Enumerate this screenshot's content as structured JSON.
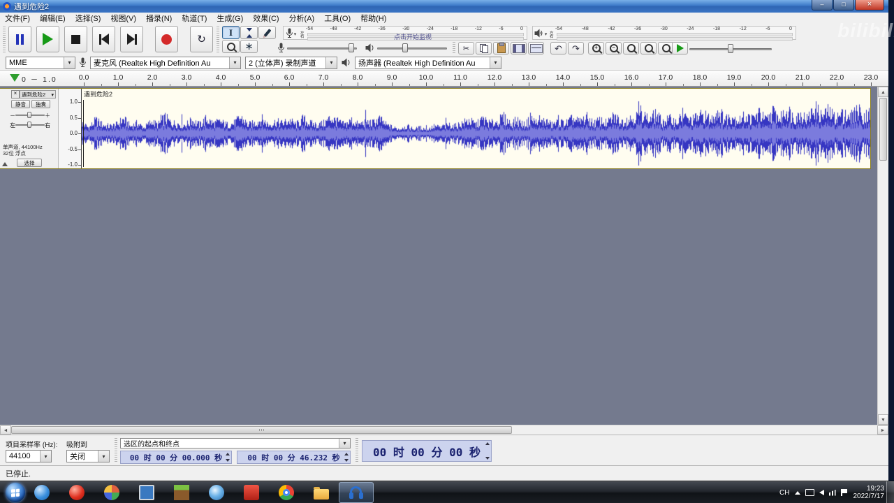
{
  "titlebar": {
    "title": "遇到危险2"
  },
  "menubar": {
    "items": [
      {
        "id": "file",
        "label": "文件(F)"
      },
      {
        "id": "edit",
        "label": "编辑(E)"
      },
      {
        "id": "select",
        "label": "选择(S)"
      },
      {
        "id": "view",
        "label": "视图(V)"
      },
      {
        "id": "transport",
        "label": "播录(N)"
      },
      {
        "id": "tracks",
        "label": "轨道(T)"
      },
      {
        "id": "generate",
        "label": "生成(G)"
      },
      {
        "id": "effect",
        "label": "效果(C)"
      },
      {
        "id": "analyze",
        "label": "分析(A)"
      },
      {
        "id": "tools",
        "label": "工具(O)"
      },
      {
        "id": "help",
        "label": "帮助(H)"
      }
    ]
  },
  "meters": {
    "scale": [
      "-54",
      "-48",
      "-42",
      "-36",
      "-30",
      "-24",
      "-18",
      "-12",
      "-6",
      "0"
    ],
    "record_hint": "点击开始监视",
    "channels": [
      "左",
      "右"
    ]
  },
  "mixer": {
    "record_level": 0.92,
    "playback_level": 0.4,
    "play_speed": 0.5
  },
  "device": {
    "host": "MME",
    "input_device": "麦克风 (Realtek High Definition Au",
    "input_channels": "2 (立体声) 录制声道",
    "output_device": "扬声器 (Realtek High Definition Au"
  },
  "timeline": {
    "pre_label": "0 － 1.0",
    "labels": [
      "0.0",
      "1.0",
      "2.0",
      "3.0",
      "4.0",
      "5.0",
      "6.0",
      "7.0",
      "8.0",
      "9.0",
      "10.0",
      "11.0",
      "12.0",
      "13.0",
      "14.0",
      "15.0",
      "16.0",
      "17.0",
      "18.0",
      "19.0",
      "20.0",
      "21.0",
      "22.0",
      "23.0"
    ]
  },
  "track": {
    "name": "遇到危险2",
    "close_glyph": "×",
    "mute_label": "静音",
    "solo_label": "独奏",
    "gain_min": "－",
    "gain_max": "＋",
    "pan_left": "左",
    "pan_right": "右",
    "info_line1": "单声道, 44100Hz",
    "info_line2": "32位 浮点",
    "select_label": "选择",
    "gain": 0.5,
    "pan": 0.5,
    "ruler": [
      "1.0",
      "0.5",
      "0.0",
      "-0.5",
      "-1.0"
    ]
  },
  "waveform": {
    "peak_color": "#3636c2",
    "rms_color": "#7b7bdd",
    "background": "#fffdf0",
    "envelope": [
      0.35,
      0.2,
      0.45,
      0.3,
      0.25,
      0.3,
      0.5,
      0.25,
      0.35,
      0.2,
      0.4,
      0.3,
      0.55,
      0.35,
      0.35,
      0.3,
      0.45,
      0.3,
      0.5,
      0.35,
      0.4,
      0.3,
      0.35,
      0.55,
      0.3,
      0.35,
      0.5,
      0.3,
      0.4,
      0.35,
      0.45,
      0.3,
      0.5,
      0.35,
      0.3,
      0.35,
      0.55,
      0.4,
      0.3,
      0.45,
      0.3,
      0.4,
      0.35,
      0.5,
      0.3,
      0.2,
      0.15,
      0.25,
      0.15,
      0.2,
      0.15,
      0.25,
      0.2,
      0.3,
      0.25,
      0.35,
      0.45,
      0.3,
      0.5,
      0.35,
      0.4,
      0.55,
      0.35,
      0.45,
      0.3,
      0.5,
      0.35,
      0.45,
      0.3,
      0.4,
      0.35,
      0.5,
      0.4,
      0.55,
      0.35,
      0.45,
      0.35,
      0.6,
      0.4,
      0.5,
      0.55,
      0.75,
      0.45,
      0.65,
      0.4,
      0.5,
      0.4,
      0.6,
      0.45,
      0.55,
      0.65,
      0.45,
      0.8,
      0.5,
      0.6,
      0.45,
      0.6,
      0.5,
      0.7,
      0.45,
      0.75,
      0.5,
      0.85,
      0.55,
      0.65,
      0.5,
      0.9,
      0.6,
      0.75,
      0.55,
      0.65,
      0.5,
      0.8,
      0.6,
      0.7
    ]
  },
  "selection_bar": {
    "rate_label": "项目采样率 (Hz):",
    "rate_value": "44100",
    "snap_label": "吸附到",
    "snap_value": "关闭",
    "range_mode": "选区的起点和终点",
    "selection_start": "00 时 00 分 00.000 秒",
    "selection_end": "00 时 00 分 46.232 秒",
    "audio_position": "00 时 00 分 00 秒"
  },
  "status": {
    "message": "已停止."
  },
  "taskbar": {
    "icons": [
      {
        "id": "blue-app",
        "kind": "blue-circle"
      },
      {
        "id": "red-app",
        "kind": "red-circle"
      },
      {
        "id": "pinwheel-app",
        "kind": "pinwheel"
      },
      {
        "id": "system-app",
        "kind": "monitor"
      },
      {
        "id": "minecraft",
        "kind": "grass"
      },
      {
        "id": "globe-app",
        "kind": "globe"
      },
      {
        "id": "red-tool-app",
        "kind": "redtool"
      },
      {
        "id": "chrome",
        "kind": "chrome"
      },
      {
        "id": "file-explorer",
        "kind": "folder"
      },
      {
        "id": "audacity",
        "kind": "headphones",
        "active": true
      }
    ],
    "tray": {
      "lang": "CH",
      "time": "19:23",
      "date": "2022/7/17"
    }
  },
  "watermark": "bilibili"
}
